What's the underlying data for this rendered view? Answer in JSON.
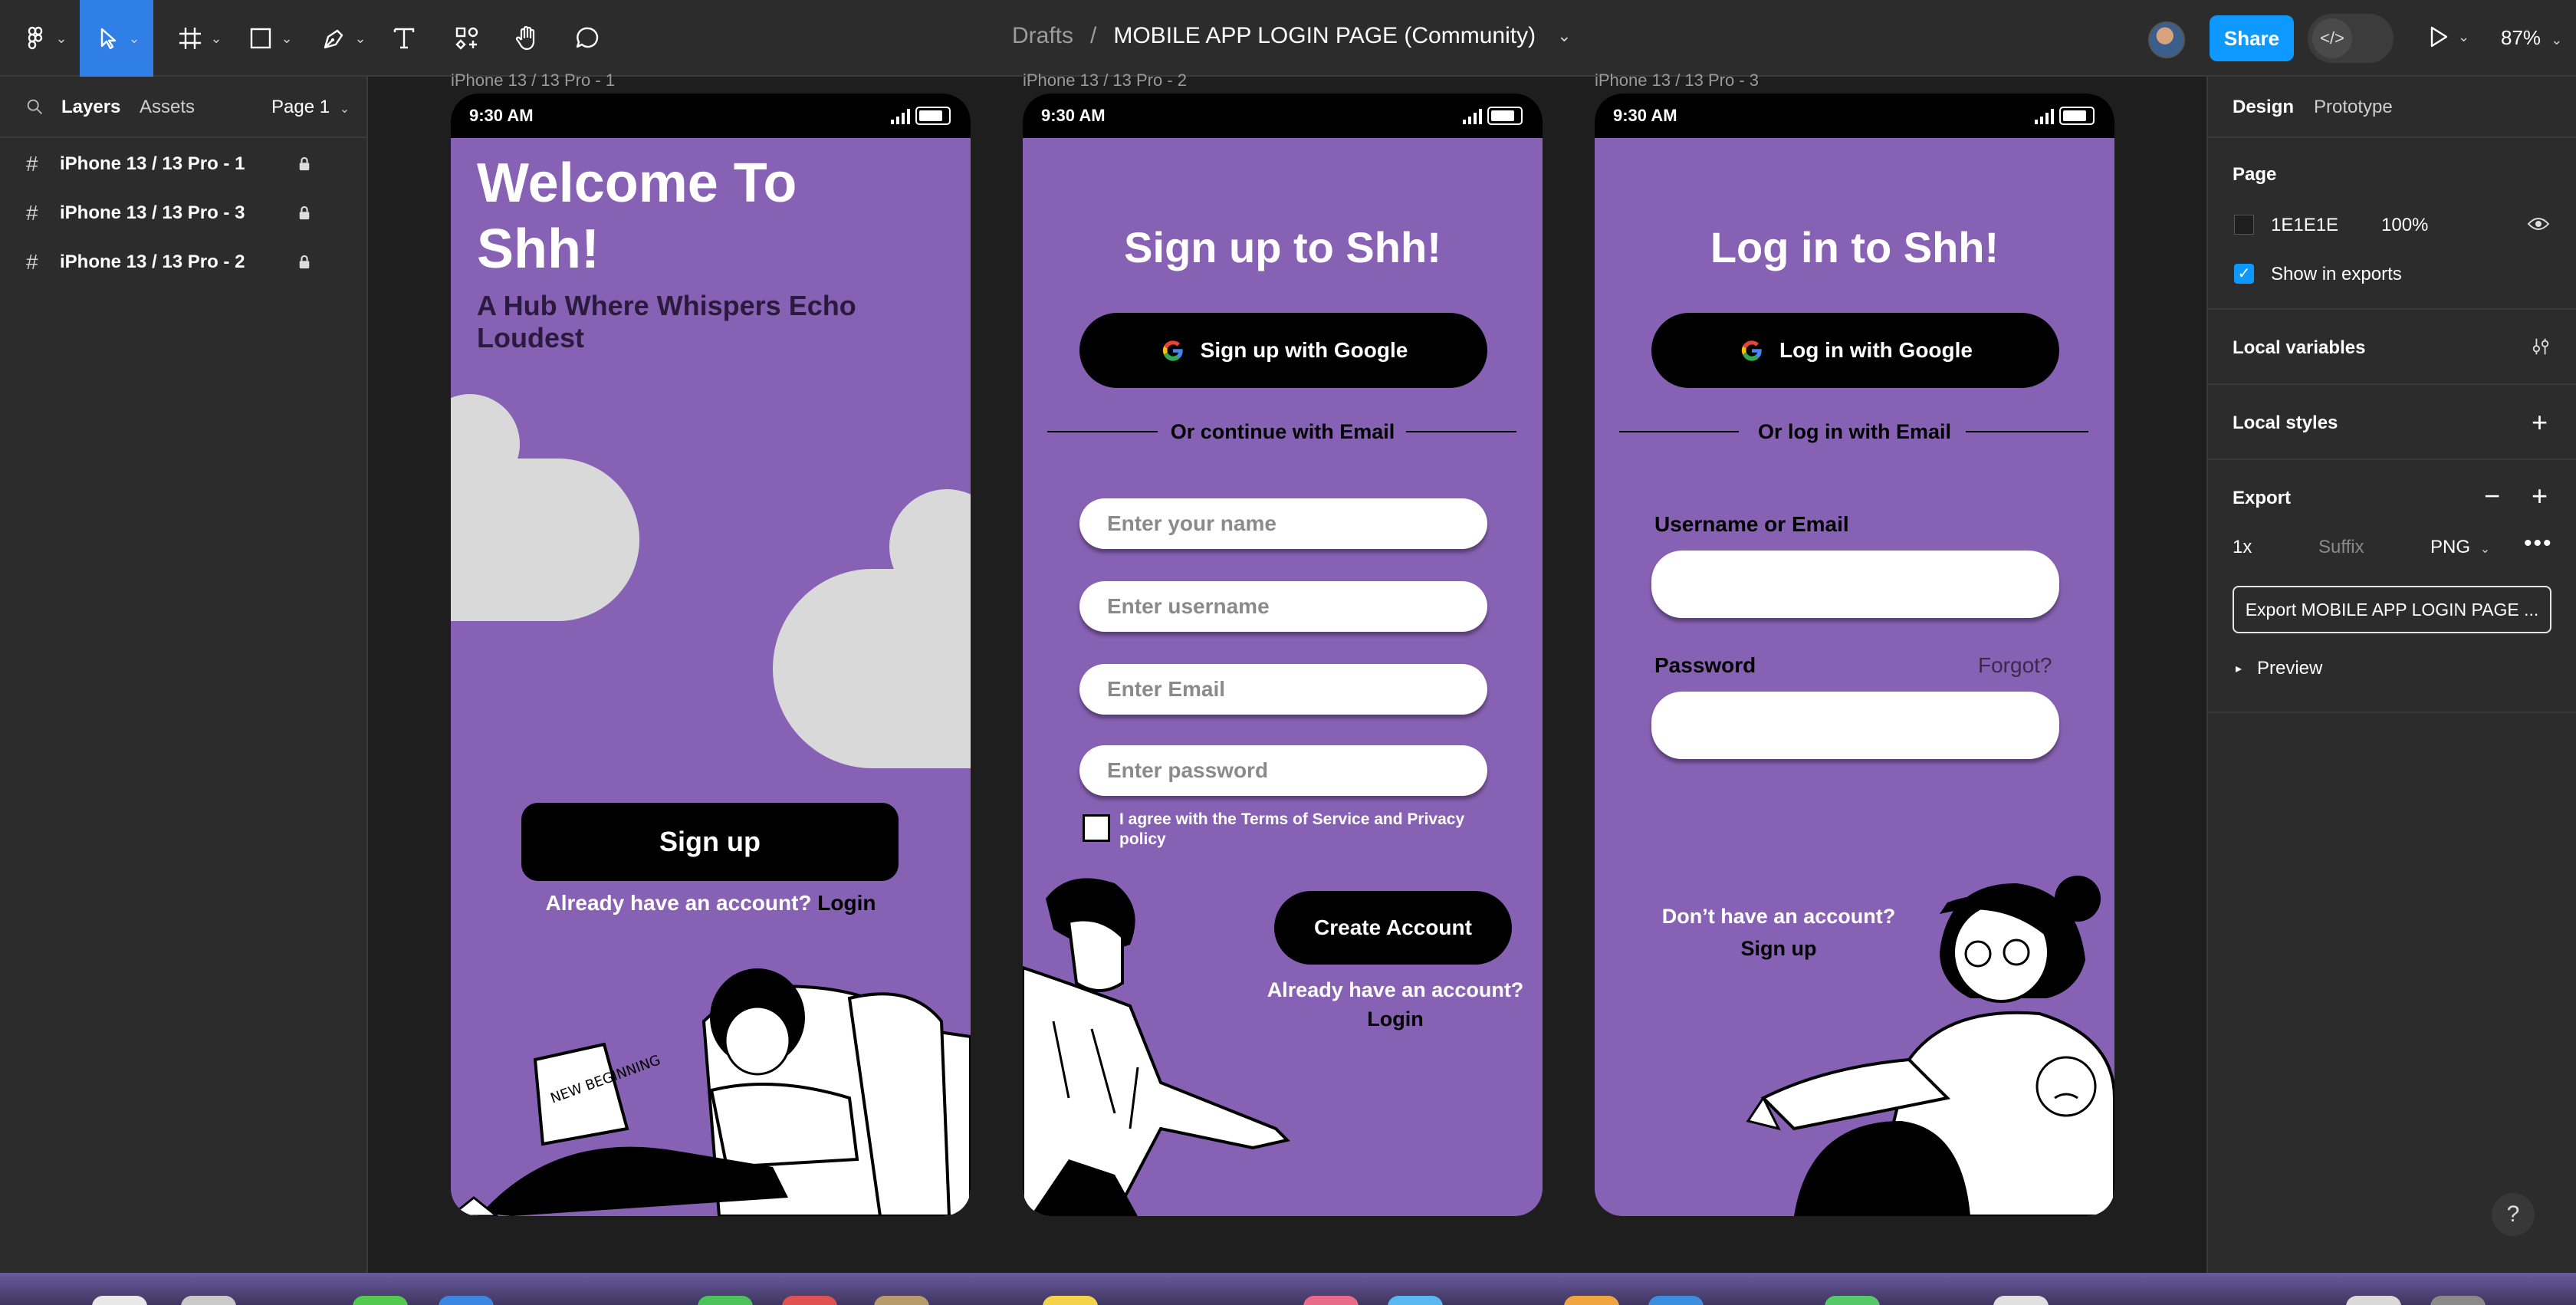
{
  "toolbar": {
    "breadcrumb_parent": "Drafts",
    "breadcrumb_sep": "/",
    "file_title": "MOBILE APP LOGIN PAGE (Community)",
    "share_label": "Share",
    "zoom": "87%"
  },
  "left_panel": {
    "tabs": [
      "Layers",
      "Assets"
    ],
    "page_selector": "Page 1",
    "layers": [
      {
        "name": "iPhone 13 / 13 Pro - 1"
      },
      {
        "name": "iPhone 13 / 13 Pro - 3"
      },
      {
        "name": "iPhone 13 / 13 Pro - 2"
      }
    ]
  },
  "right_panel": {
    "tabs": [
      "Design",
      "Prototype"
    ],
    "page_heading": "Page",
    "page_color": "1E1E1E",
    "page_opacity": "100%",
    "show_in_exports": "Show in exports",
    "local_variables": "Local variables",
    "local_styles": "Local styles",
    "export_heading": "Export",
    "export_scale": "1x",
    "export_suffix_placeholder": "Suffix",
    "export_format": "PNG",
    "export_button": "Export MOBILE APP LOGIN PAGE ...",
    "preview": "Preview"
  },
  "frames": [
    {
      "label": "iPhone 13 / 13 Pro - 1",
      "time": "9:30 AM",
      "title_line1": "Welcome To",
      "title_line2": "Shh!",
      "subtitle_line1": "A Hub Where Whispers Echo",
      "subtitle_line2": "Loudest",
      "signup_button": "Sign up",
      "already_text": "Already have an account?",
      "login_link": "Login",
      "magazine_text": "NEW BEGINNING"
    },
    {
      "label": "iPhone 13 / 13 Pro - 2",
      "time": "9:30 AM",
      "title": "Sign up to Shh!",
      "google_button": "Sign up with Google",
      "divider_text": "Or continue with Email",
      "name_placeholder": "Enter your name",
      "username_placeholder": "Enter username",
      "email_placeholder": "Enter  Email",
      "password_placeholder": "Enter password",
      "terms_line1": "I agree with the Terms of Service and Privacy",
      "terms_line2": "policy",
      "create_button": "Create Account",
      "already_text": "Already have an account?",
      "login_link": "Login"
    },
    {
      "label": "iPhone 13 / 13 Pro - 3",
      "time": "9:30 AM",
      "title": "Log in to Shh!",
      "google_button": "Log in with Google",
      "divider_text": "Or log in with Email",
      "username_label": "Username or Email",
      "password_label": "Password",
      "forgot_link": "Forgot?",
      "no_account_text": "Don’t have an account?",
      "signup_link": "Sign up"
    }
  ],
  "colors": {
    "accent": "#2f7fe6",
    "share": "#0d99ff",
    "phone_bg": "#8761b3",
    "canvas_bg": "#1e1e1e",
    "panel_bg": "#2c2c2c"
  }
}
